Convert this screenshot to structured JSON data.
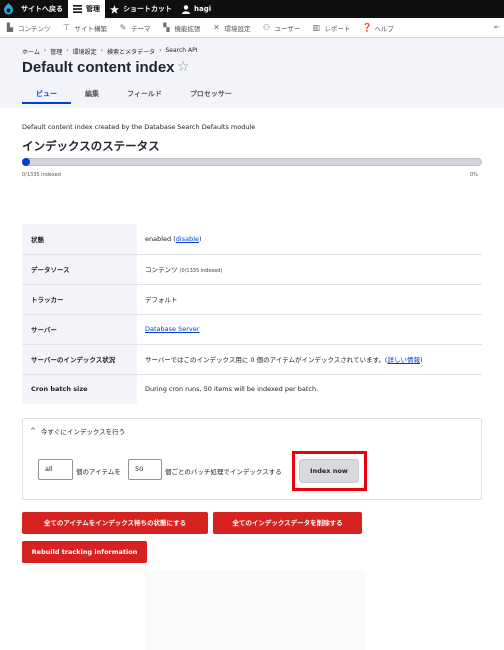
{
  "toolbar": {
    "back_label": "サイトへ戻る",
    "manage_label": "管理",
    "shortcuts_label": "ショートカット",
    "user_label": "hagi"
  },
  "tray": {
    "items": [
      {
        "label": "コンテンツ",
        "icon": "content-icon"
      },
      {
        "label": "サイト構築",
        "icon": "structure-icon"
      },
      {
        "label": "テーマ",
        "icon": "appearance-icon"
      },
      {
        "label": "機能拡張",
        "icon": "extend-icon"
      },
      {
        "label": "環境設定",
        "icon": "config-icon"
      },
      {
        "label": "ユーザー",
        "icon": "people-icon"
      },
      {
        "label": "レポート",
        "icon": "reports-icon"
      },
      {
        "label": "ヘルプ",
        "icon": "help-icon"
      }
    ],
    "toggle_glyph": "⇤"
  },
  "breadcrumb": [
    "ホーム",
    "管理",
    "環境設定",
    "検索とメタデータ",
    "Search API"
  ],
  "page": {
    "title": "Default content index",
    "star": "☆",
    "tabs": [
      "ビュー",
      "編集",
      "フィールド",
      "プロセッサー"
    ],
    "active_tab": 0,
    "description": "Default content index created by the Database Search Defaults module"
  },
  "status": {
    "heading": "インデックスのステータス",
    "indexed": 0,
    "total": 1335,
    "progress_fraction": 0.0,
    "left_label": "0/1335 indexed",
    "right_label": "0%"
  },
  "info_rows": [
    {
      "label": "状態",
      "value": "enabled (",
      "link": "disable",
      "suffix": ")",
      "small": ""
    },
    {
      "label": "データソース",
      "value": "コンテンツ ",
      "link": "",
      "suffix": "",
      "small": "(0/1335 indexed)"
    },
    {
      "label": "トラッカー",
      "value": "デフォルト",
      "link": "",
      "suffix": "",
      "small": ""
    },
    {
      "label": "サーバー",
      "value": "",
      "link": "Database Server",
      "suffix": "",
      "small": ""
    },
    {
      "label": "サーバーのインデックス状況",
      "value": "サーバーではこのインデックス用に 0 個のアイテムがインデックスされています。(",
      "link": "詳しい情報",
      "suffix": ")",
      "small": ""
    },
    {
      "label": "Cron batch size",
      "value": "During cron runs, 50 items will be indexed per batch.",
      "link": "",
      "suffix": "",
      "small": ""
    }
  ],
  "index_now": {
    "summary": "今すぐにインデックスを行う",
    "limit_value": "all",
    "text1": "個のアイテムを",
    "batch_value": "50",
    "text2": "個ごとのバッチ処理でインデックスする",
    "button_label": "Index now",
    "highlight_color": "#e8000c"
  },
  "actions": {
    "queue_all": "全てのアイテムをインデックス待ちの状態にする",
    "clear_all": "全てのインデックスデータを削除する",
    "rebuild": "Rebuild tracking information"
  },
  "colors": {
    "accent": "#003ecc",
    "danger": "#d72222",
    "toolbar_bg": "#0f0f0f"
  }
}
